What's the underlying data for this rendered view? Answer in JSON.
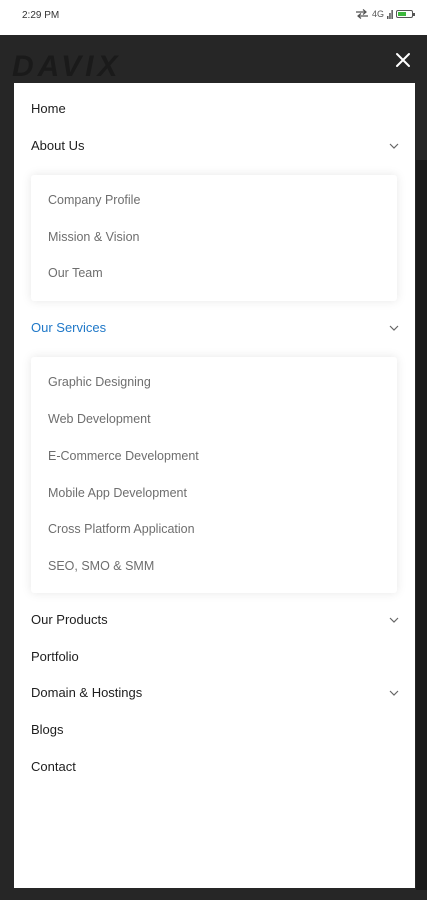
{
  "status_bar": {
    "time": "2:29 PM",
    "network": "4G",
    "battery_level": 0.6,
    "battery_color": "#3db83d"
  },
  "header": {
    "logo_text": "DAVIX",
    "close_icon": "close-icon"
  },
  "colors": {
    "active": "#1f78c8",
    "text": "#1e1e1e",
    "subtext": "#6e6e6e",
    "overlay": "#262626"
  },
  "menu": {
    "home": "Home",
    "about": {
      "label": "About Us",
      "items": [
        "Company Profile",
        "Mission & Vision",
        "Our Team"
      ]
    },
    "services": {
      "label": "Our Services",
      "items": [
        "Graphic Designing",
        "Web Development",
        "E-Commerce Development",
        "Mobile App Development",
        "Cross Platform Application",
        "SEO, SMO & SMM"
      ]
    },
    "products": "Our Products",
    "portfolio": "Portfolio",
    "domain": "Domain & Hostings",
    "blogs": "Blogs",
    "contact": "Contact"
  }
}
